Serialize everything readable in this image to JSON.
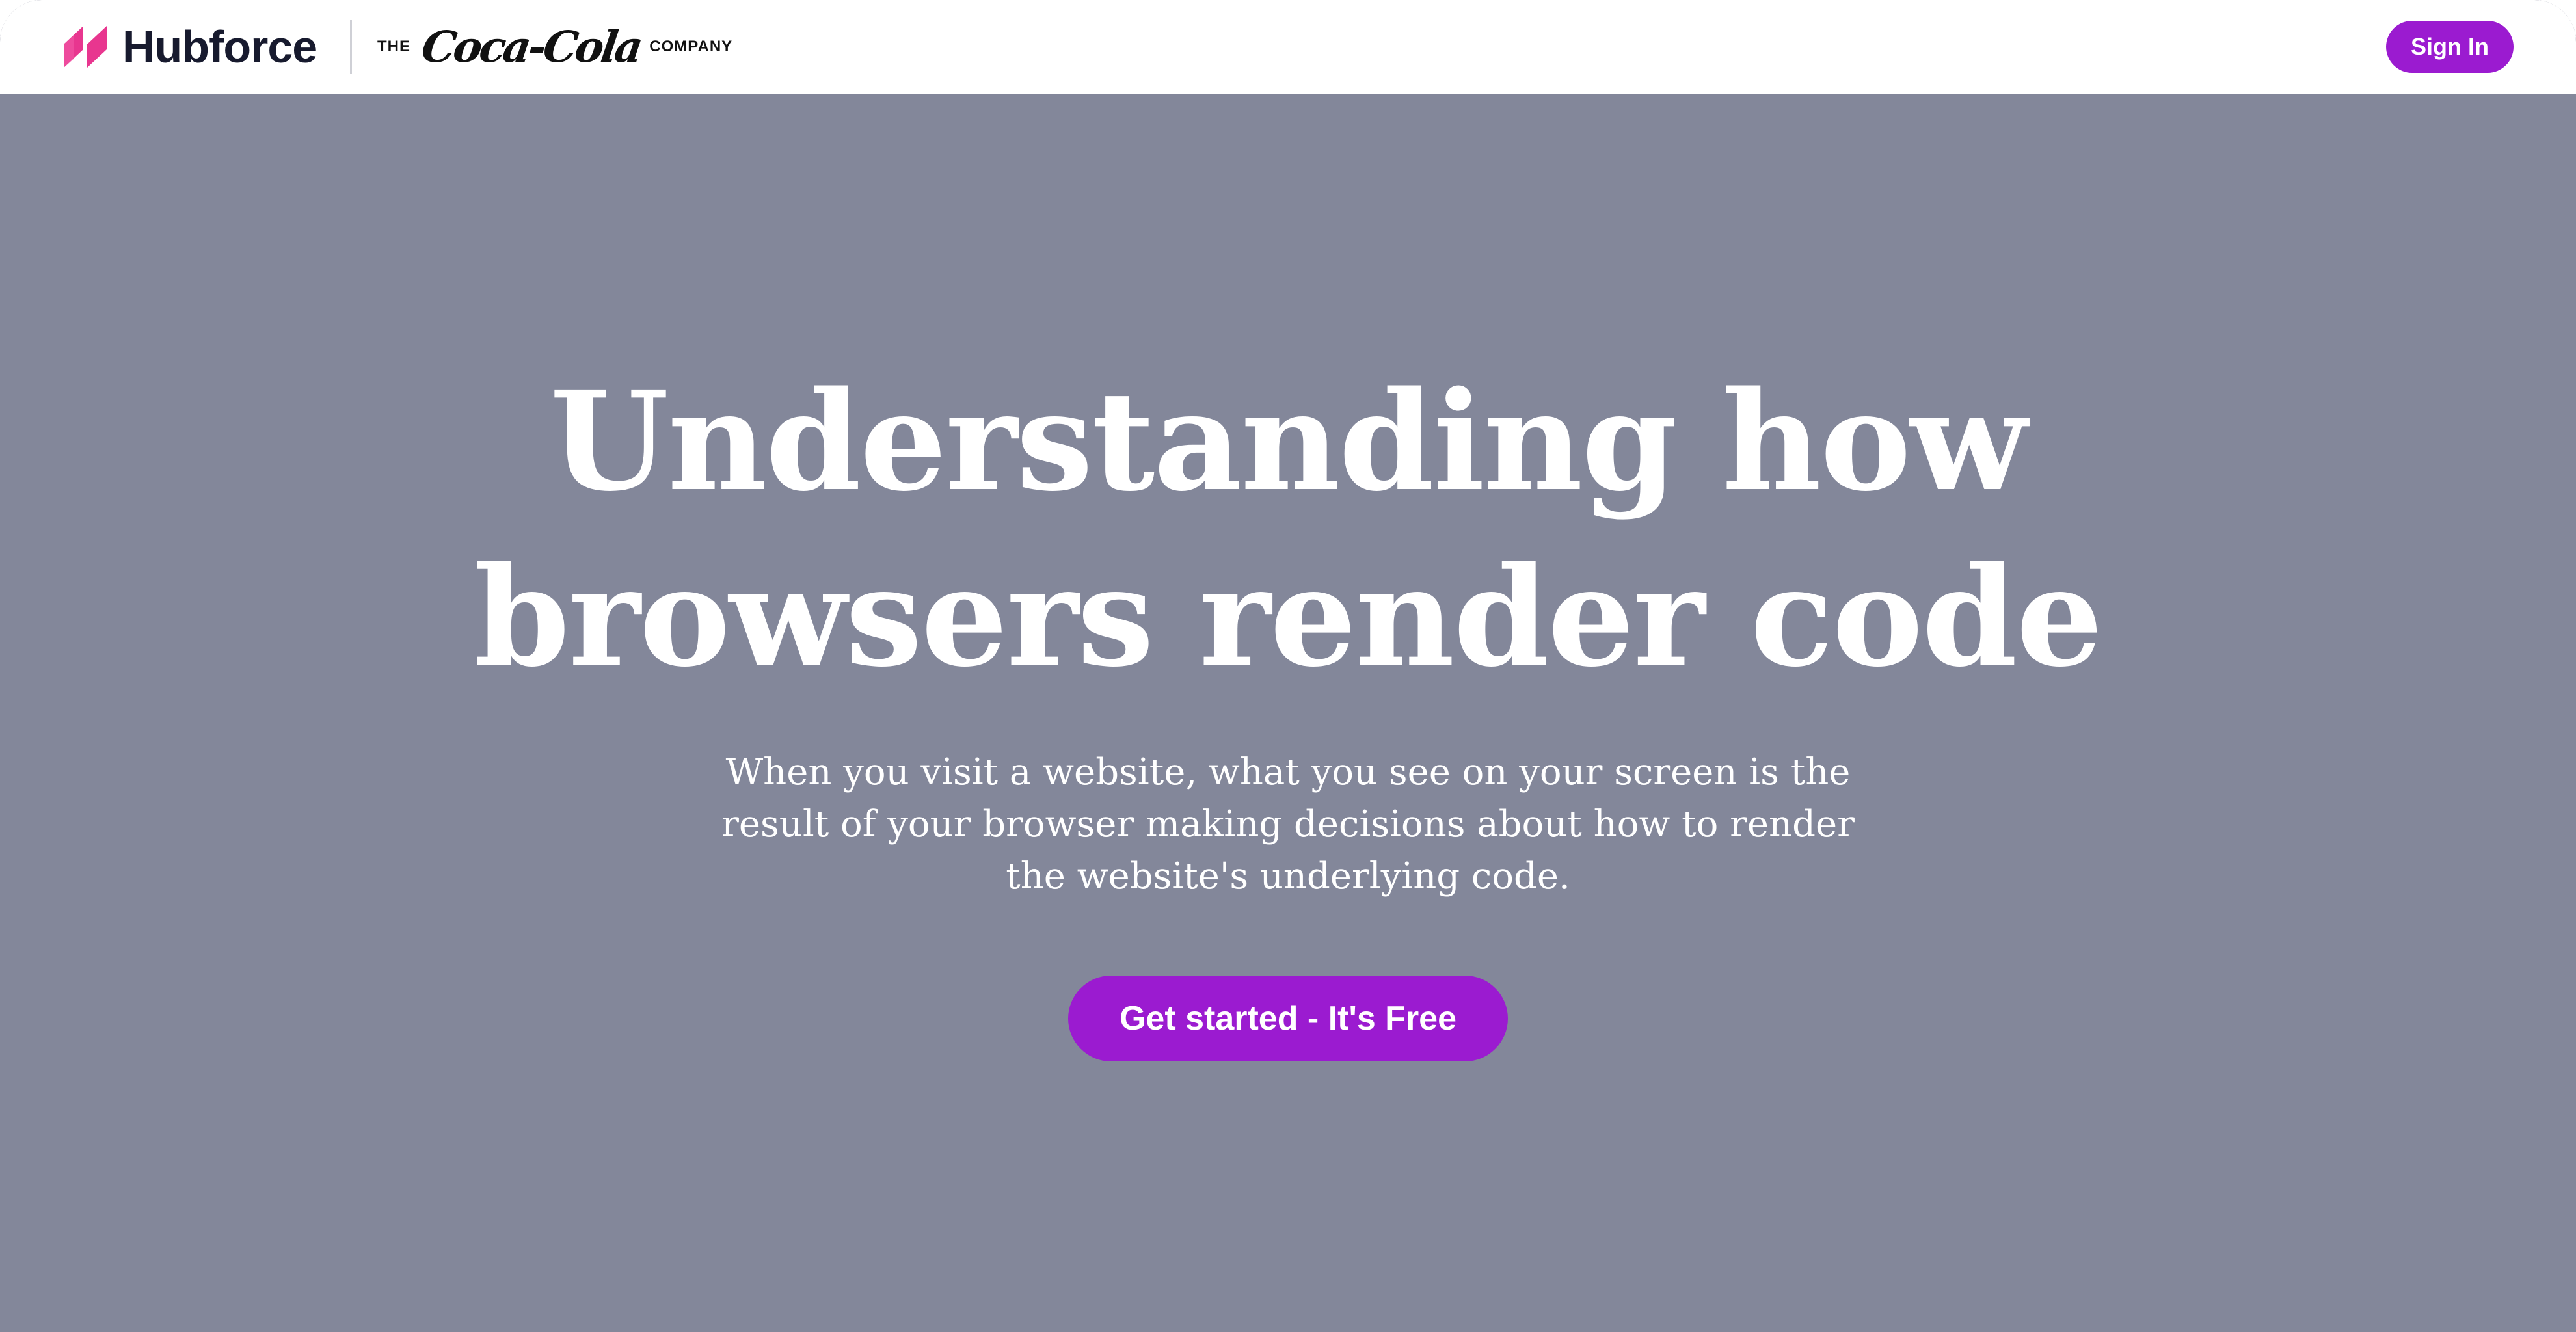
{
  "header": {
    "brand_name": "Hubforce",
    "partner": {
      "prefix": "THE",
      "logo_text": "Coca-Cola",
      "suffix": "COMPANY"
    },
    "signin_label": "Sign In"
  },
  "hero": {
    "title": "Understanding how browsers render code",
    "subtitle": "When you visit a website, what you see on your screen is the result of your browser making decisions about how to render the website's underlying code.",
    "cta_label": "Get started - It's Free"
  },
  "icons": {
    "brand_logo": "hubforce-logo-icon"
  },
  "colors": {
    "hero_background": "#83879a",
    "accent": "#9b1bd0",
    "brand_mark": "#e8368f",
    "header_background": "#ffffff",
    "brand_text": "#171a2e"
  }
}
